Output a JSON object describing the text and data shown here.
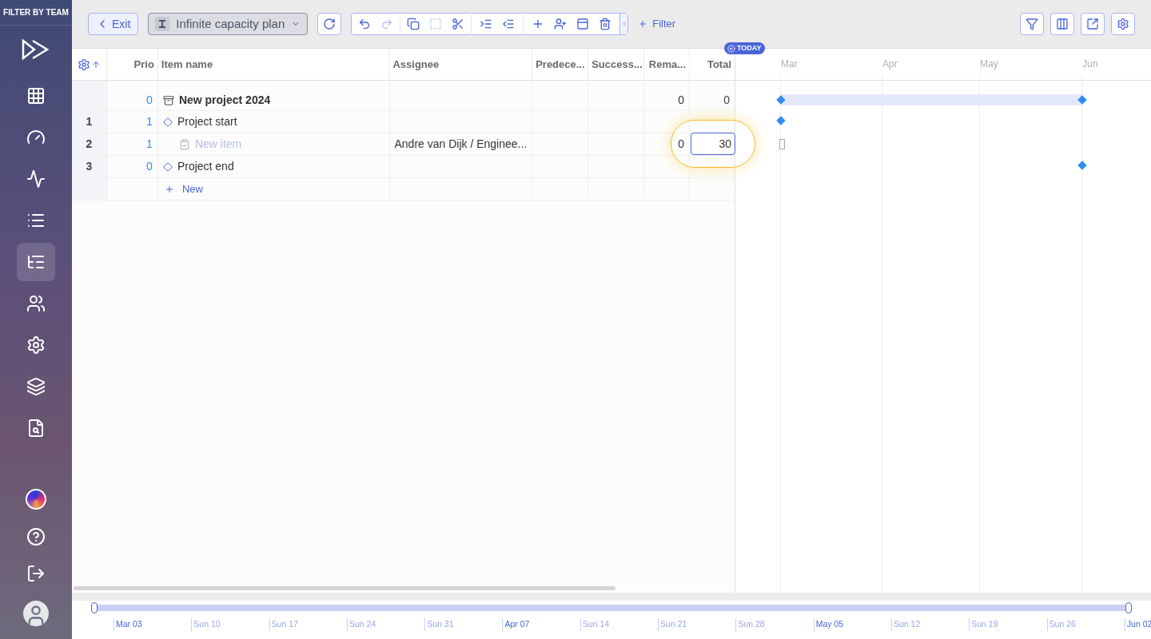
{
  "sidebar": {
    "filter_label": "FILTER BY TEAM",
    "items": [
      {
        "kind": "table",
        "selected": false
      },
      {
        "kind": "gauge",
        "selected": false
      },
      {
        "kind": "activity",
        "selected": false
      },
      {
        "kind": "list",
        "selected": false
      },
      {
        "kind": "gantt",
        "selected": true
      },
      {
        "kind": "users",
        "selected": false
      },
      {
        "kind": "settings",
        "selected": false
      },
      {
        "kind": "layers",
        "selected": false
      },
      {
        "kind": "analysis",
        "selected": false
      }
    ],
    "bottom": [
      {
        "kind": "orb"
      },
      {
        "kind": "help"
      },
      {
        "kind": "logout"
      },
      {
        "kind": "avatar"
      }
    ]
  },
  "toolbar": {
    "exit": "Exit",
    "plan": "Infinite capacity plan",
    "filter": "Filter"
  },
  "table": {
    "columns": [
      "Prio",
      "Item name",
      "Assignee",
      "Predece...",
      "Success...",
      "Rema...",
      "Total"
    ],
    "rows": [
      {
        "kind": "group",
        "number": "",
        "prio": "0",
        "name": "New project 2024",
        "assignee": "",
        "remaining": "0",
        "total": "0",
        "gantt": {
          "kind": "span"
        },
        "editing": false
      },
      {
        "kind": "milestone",
        "number": "1",
        "prio": "1",
        "name": "Project start",
        "assignee": "",
        "remaining": "",
        "total": "",
        "gantt": {
          "kind": "start"
        },
        "editing": false
      },
      {
        "kind": "task",
        "number": "2",
        "prio": "1",
        "name": "New item",
        "assignee": "Andre van Dijk / Enginee...",
        "remaining": "0",
        "total": "30",
        "gantt": {
          "kind": "pending"
        },
        "editing": true
      },
      {
        "kind": "milestone",
        "number": "3",
        "prio": "0",
        "name": "Project end",
        "assignee": "",
        "remaining": "",
        "total": "",
        "gantt": {
          "kind": "end"
        },
        "editing": false
      }
    ],
    "new_row": "New"
  },
  "gantt": {
    "today": "TODAY",
    "months": [
      "Mar",
      "Apr",
      "May",
      "Jun"
    ]
  },
  "timeline": {
    "range": {
      "level": 1
    },
    "ticks": [
      {
        "label": "Mar 03",
        "major": true
      },
      {
        "label": "Sun 10",
        "major": false
      },
      {
        "label": "Sun 17",
        "major": false
      },
      {
        "label": "Sun 24",
        "major": false
      },
      {
        "label": "Sun 31",
        "major": false
      },
      {
        "label": "Apr 07",
        "major": true
      },
      {
        "label": "Sun 14",
        "major": false
      },
      {
        "label": "Sun 21",
        "major": false
      },
      {
        "label": "Sun 28",
        "major": false
      },
      {
        "label": "May 05",
        "major": true
      },
      {
        "label": "Sun 12",
        "major": false
      },
      {
        "label": "Sun 19",
        "major": false
      },
      {
        "label": "Sun 26",
        "major": false
      },
      {
        "label": "Jun 02",
        "major": true
      }
    ]
  }
}
